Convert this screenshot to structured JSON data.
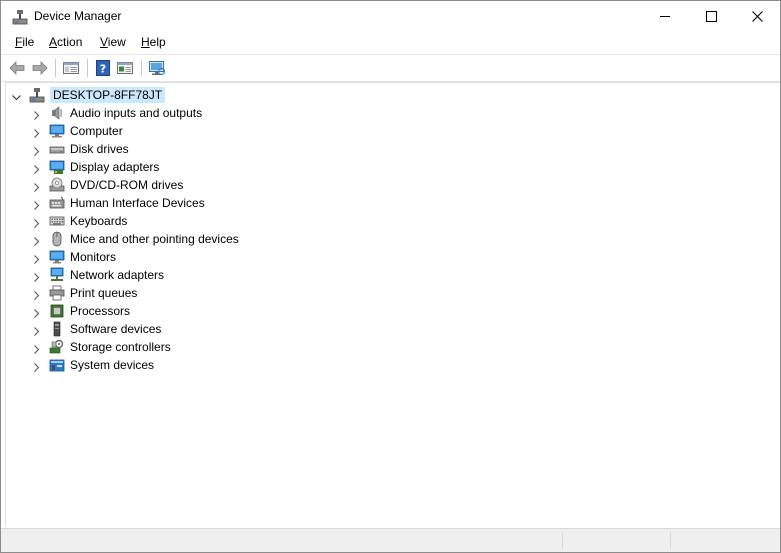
{
  "window": {
    "title": "Device Manager"
  },
  "menu": {
    "items": [
      {
        "label_u": "F",
        "label_rest": "ile"
      },
      {
        "label_u": "A",
        "label_rest": "ction"
      },
      {
        "label_u": "V",
        "label_rest": "iew"
      },
      {
        "label_u": "H",
        "label_rest": "elp"
      }
    ]
  },
  "toolbar": {
    "buttons": [
      "back-arrow-icon",
      "forward-arrow-icon",
      "show-hide-console-tree-icon",
      "help-icon",
      "properties-icon",
      "scan-hardware-icon"
    ]
  },
  "tree": {
    "root": "DESKTOP-8FF78JT",
    "categories": [
      {
        "label": "Audio inputs and outputs",
        "icon": "speaker-icon"
      },
      {
        "label": "Computer",
        "icon": "computer-icon"
      },
      {
        "label": "Disk drives",
        "icon": "disk-drive-icon"
      },
      {
        "label": "Display adapters",
        "icon": "display-adapter-icon"
      },
      {
        "label": "DVD/CD-ROM drives",
        "icon": "dvd-drive-icon"
      },
      {
        "label": "Human Interface Devices",
        "icon": "hid-icon"
      },
      {
        "label": "Keyboards",
        "icon": "keyboard-icon"
      },
      {
        "label": "Mice and other pointing devices",
        "icon": "mouse-icon"
      },
      {
        "label": "Monitors",
        "icon": "monitor-icon"
      },
      {
        "label": "Network adapters",
        "icon": "network-adapter-icon"
      },
      {
        "label": "Print queues",
        "icon": "printer-icon"
      },
      {
        "label": "Processors",
        "icon": "processor-icon"
      },
      {
        "label": "Software devices",
        "icon": "software-device-icon"
      },
      {
        "label": "Storage controllers",
        "icon": "storage-controller-icon"
      },
      {
        "label": "System devices",
        "icon": "system-devices-icon"
      }
    ]
  },
  "colors": {
    "selection": "#cce8ff",
    "accent_blue": "#2b7bd3"
  }
}
